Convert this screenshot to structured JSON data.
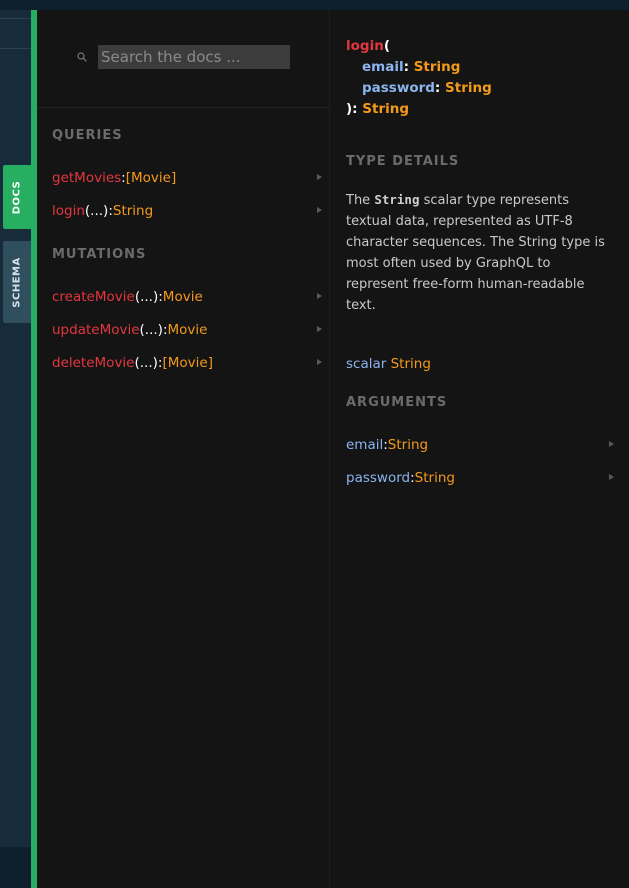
{
  "tabs": {
    "docs": "DOCS",
    "schema": "SCHEMA"
  },
  "search": {
    "placeholder": "Search the docs ...",
    "value": ""
  },
  "queries": {
    "title": "QUERIES",
    "items": [
      {
        "name": "getMovies",
        "args": "",
        "sep": ": ",
        "type": "[Movie]"
      },
      {
        "name": "login",
        "args": "(...)",
        "sep": ": ",
        "type": "String"
      }
    ]
  },
  "mutations": {
    "title": "MUTATIONS",
    "items": [
      {
        "name": "createMovie",
        "args": "(...)",
        "sep": ": ",
        "type": "Movie"
      },
      {
        "name": "updateMovie",
        "args": "(...)",
        "sep": ": ",
        "type": "Movie"
      },
      {
        "name": "deleteMovie",
        "args": "(...)",
        "sep": ": ",
        "type": "[Movie]"
      }
    ]
  },
  "detail": {
    "signature": {
      "name": "login",
      "open": "(",
      "args": [
        {
          "name": "email",
          "type": "String"
        },
        {
          "name": "password",
          "type": "String"
        }
      ],
      "close": "): ",
      "type": "String"
    },
    "type_details_title": "TYPE DETAILS",
    "description": {
      "before": "The ",
      "code": "String",
      "after": " scalar type represents textual data, represented as UTF-8 character sequences. The String type is most often used by GraphQL to represent free-form human-readable text."
    },
    "scalar": {
      "keyword": "scalar",
      "type": "String"
    },
    "arguments_title": "ARGUMENTS",
    "arguments": [
      {
        "name": "email",
        "sep": ": ",
        "type": "String"
      },
      {
        "name": "password",
        "sep": ": ",
        "type": "String"
      }
    ]
  },
  "colors": {
    "accent": "#27ae60",
    "field_name": "#e2373f",
    "type": "#f39a1b",
    "arg_name": "#8cb4ee"
  }
}
